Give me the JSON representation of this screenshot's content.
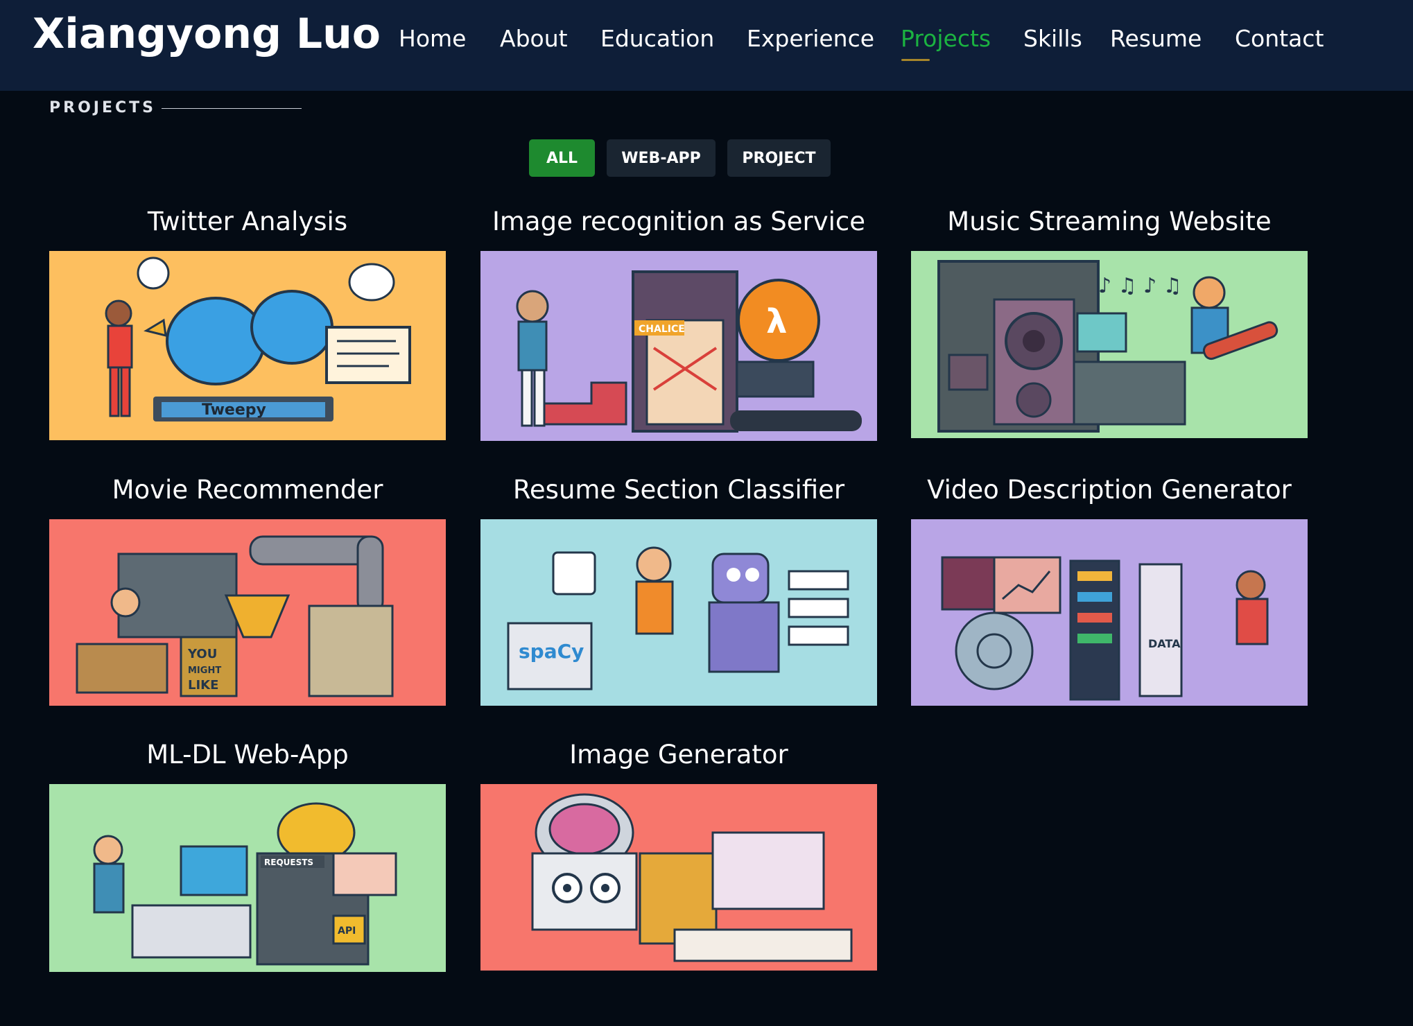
{
  "header": {
    "logo": "Xiangyong Luo",
    "nav": [
      {
        "label": "Home",
        "active": false
      },
      {
        "label": "About",
        "active": false
      },
      {
        "label": "Education",
        "active": false
      },
      {
        "label": "Experience",
        "active": false
      },
      {
        "label": "Projects",
        "active": true
      },
      {
        "label": "Skills",
        "active": false
      },
      {
        "label": "Resume",
        "active": false
      },
      {
        "label": "Contact",
        "active": false
      }
    ]
  },
  "section": {
    "label": "PROJECTS"
  },
  "filters": [
    {
      "label": "ALL",
      "active": true
    },
    {
      "label": "WEB-APP",
      "active": false
    },
    {
      "label": "PROJECT",
      "active": false
    }
  ],
  "projects": [
    {
      "title": "Twitter Analysis",
      "bg": "#fdbf5f",
      "illustration_text": "Tweepy"
    },
    {
      "title": "Image recognition as Service",
      "bg": "#b9a5e6",
      "illustration_text": "CHALICE"
    },
    {
      "title": "Music Streaming Website",
      "bg": "#a8e3aa",
      "illustration_text": ""
    },
    {
      "title": "Movie Recommender",
      "bg": "#f7766c",
      "illustration_text": "YOU MIGHT LIKE"
    },
    {
      "title": "Resume Section Classifier",
      "bg": "#a6dde3",
      "illustration_text": "spaCy"
    },
    {
      "title": "Video Description Generator",
      "bg": "#b9a5e6",
      "illustration_text": "DATA"
    },
    {
      "title": "ML-DL Web-App",
      "bg": "#a8e3aa",
      "illustration_text": "REQUESTS"
    },
    {
      "title": "Image Generator",
      "bg": "#f7766c",
      "illustration_text": ""
    }
  ],
  "colors": {
    "header_bg": "#0e1e38",
    "page_bg": "#040b14",
    "accent_green": "#1bb341",
    "filter_active": "#1e8a2f",
    "filter_inactive": "#1a2531"
  }
}
